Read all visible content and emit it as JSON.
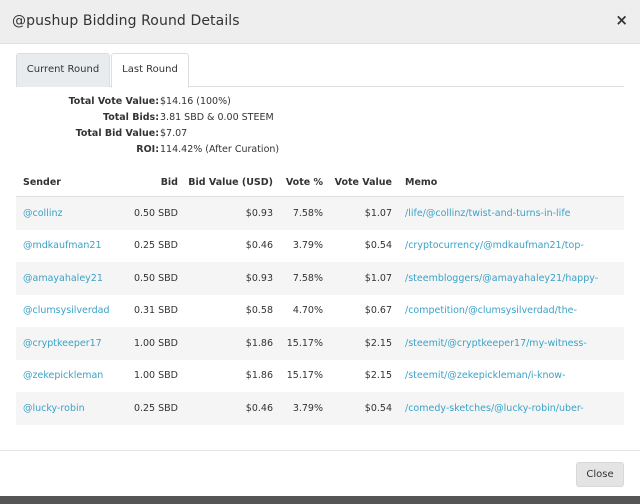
{
  "modal": {
    "title": "@pushup Bidding Round Details",
    "close_icon": "×",
    "close_button": "Close"
  },
  "tabs": [
    {
      "label": "Current Round",
      "active": false
    },
    {
      "label": "Last Round",
      "active": true
    }
  ],
  "summary": [
    {
      "label": "Total Vote Value:",
      "value": "$14.16 (100%)"
    },
    {
      "label": "Total Bids:",
      "value": "3.81 SBD & 0.00 STEEM"
    },
    {
      "label": "Total Bid Value:",
      "value": "$7.07"
    },
    {
      "label": "ROI:",
      "value": "114.42% (After Curation)"
    }
  ],
  "table": {
    "headers": [
      "Sender",
      "Bid",
      "Bid Value (USD)",
      "Vote %",
      "Vote Value",
      "Memo"
    ],
    "rows": [
      {
        "sender": "@collinz",
        "bid": "0.50 SBD",
        "bid_value": "$0.93",
        "vote_pct": "7.58%",
        "vote_value": "$1.07",
        "memo": "/life/@collinz/twist-and-turns-in-life"
      },
      {
        "sender": "@mdkaufman21",
        "bid": "0.25 SBD",
        "bid_value": "$0.46",
        "vote_pct": "3.79%",
        "vote_value": "$0.54",
        "memo": "/cryptocurrency/@mdkaufman21/top-"
      },
      {
        "sender": "@amayahaley21",
        "bid": "0.50 SBD",
        "bid_value": "$0.93",
        "vote_pct": "7.58%",
        "vote_value": "$1.07",
        "memo": "/steembloggers/@amayahaley21/happy-"
      },
      {
        "sender": "@clumsysilverdad",
        "bid": "0.31 SBD",
        "bid_value": "$0.58",
        "vote_pct": "4.70%",
        "vote_value": "$0.67",
        "memo": "/competition/@clumsysilverdad/the-"
      },
      {
        "sender": "@cryptkeeper17",
        "bid": "1.00 SBD",
        "bid_value": "$1.86",
        "vote_pct": "15.17%",
        "vote_value": "$2.15",
        "memo": "/steemit/@cryptkeeper17/my-witness-"
      },
      {
        "sender": "@zekepickleman",
        "bid": "1.00 SBD",
        "bid_value": "$1.86",
        "vote_pct": "15.17%",
        "vote_value": "$2.15",
        "memo": "/steemit/@zekepickleman/i-know-"
      },
      {
        "sender": "@lucky-robin",
        "bid": "0.25 SBD",
        "bid_value": "$0.46",
        "vote_pct": "3.79%",
        "vote_value": "$0.54",
        "memo": "/comedy-sketches/@lucky-robin/uber-"
      }
    ]
  },
  "colors": {
    "link": "#3aa2c6",
    "header_bg": "#eeeeee",
    "stripe": "#f5f5f5"
  }
}
